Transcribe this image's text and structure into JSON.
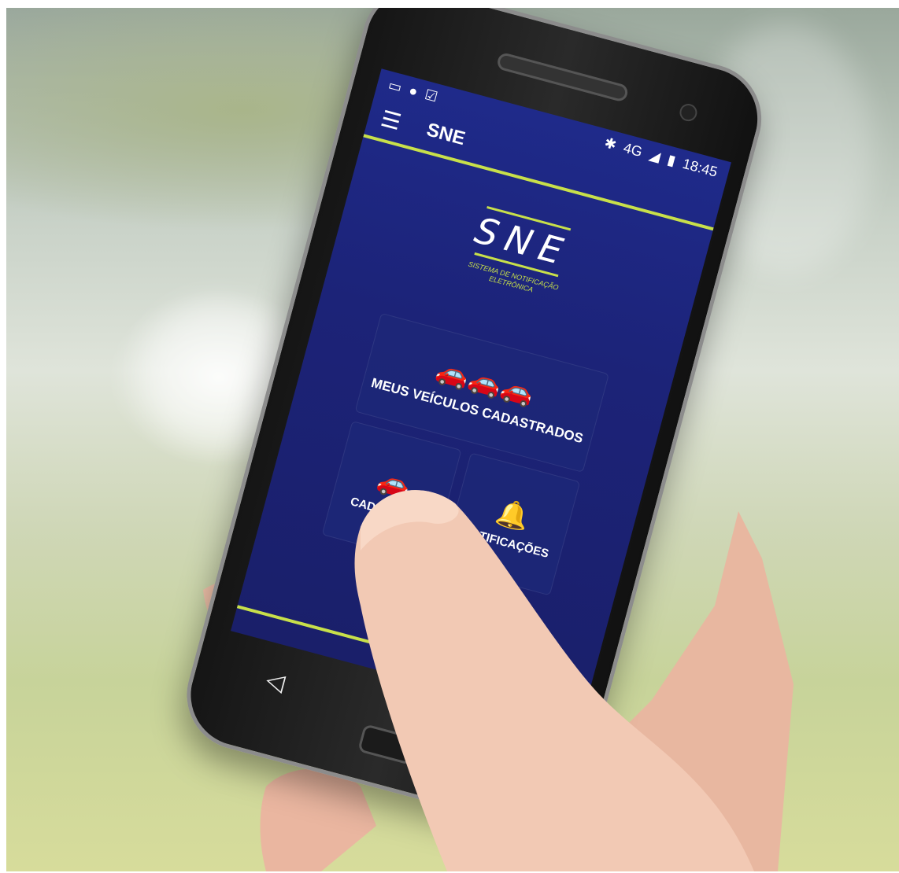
{
  "status_bar": {
    "left_icons": [
      "sim-icon",
      "whatsapp-icon",
      "clipboard-check-icon"
    ],
    "right_icons": [
      "bluetooth-icon",
      "signal-icon",
      "battery-icon"
    ],
    "network": "4G",
    "time": "18:45"
  },
  "app_bar": {
    "title": "SNE",
    "menu_icon": "hamburger-menu-icon"
  },
  "logo": {
    "text": "SNE",
    "subtitle": "SISTEMA DE NOTIFICAÇÃO ELETRÔNICA"
  },
  "tiles": {
    "main": {
      "label": "MEUS VEÍCULOS CADASTRADOS",
      "icon": "three-cars-icon"
    },
    "cadastrar": {
      "label": "CADASTRAR",
      "icon": "car-add-icon"
    },
    "notificacoes": {
      "label": "NOTIFICAÇÕES",
      "icon": "bell-icon"
    }
  },
  "colors": {
    "accent": "#c8e04a",
    "screen_bg": "#1c2378"
  }
}
